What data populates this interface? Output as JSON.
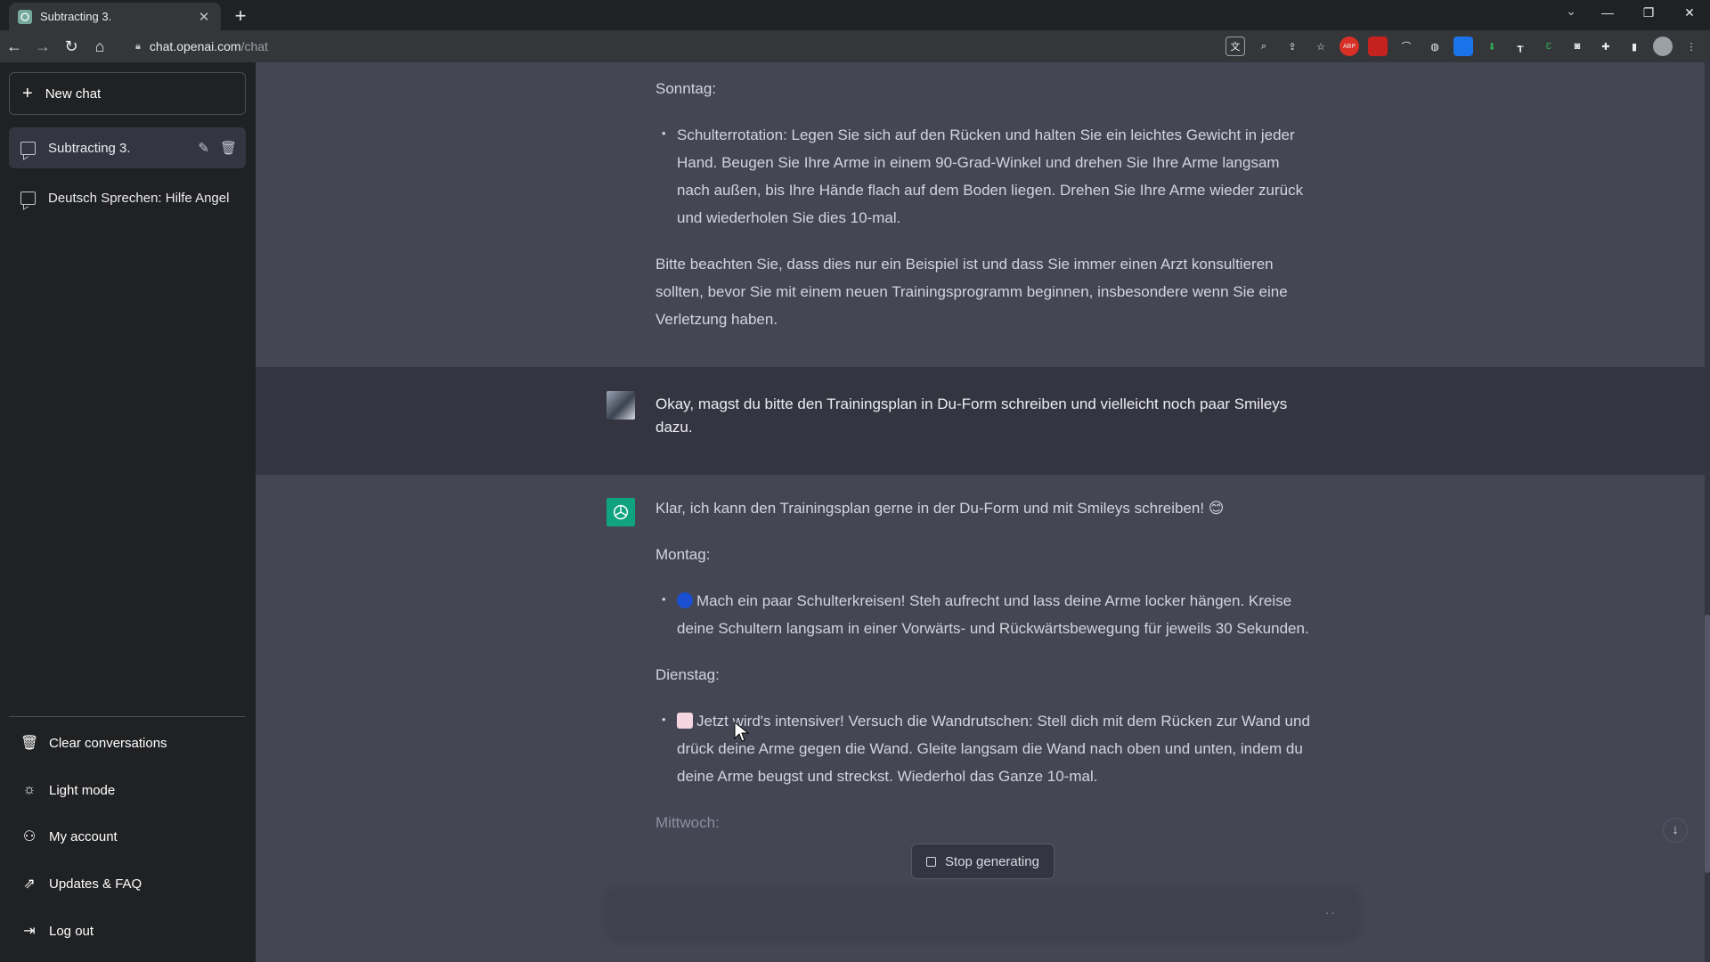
{
  "browser": {
    "tab_title": "Subtracting 3.",
    "tab_close": "✕",
    "new_tab": "+",
    "url_host": "chat.openai.com",
    "url_path": "/chat",
    "window_controls": [
      "—",
      "❐",
      "✕"
    ]
  },
  "sidebar": {
    "new_chat_label": "New chat",
    "conversations": [
      {
        "label": "Subtracting 3.",
        "active": true
      },
      {
        "label": "Deutsch Sprechen: Hilfe Angel",
        "active": false
      }
    ],
    "menu": [
      {
        "label": "Clear conversations",
        "icon": "trash-icon"
      },
      {
        "label": "Light mode",
        "icon": "sun-icon"
      },
      {
        "label": "My account",
        "icon": "user-icon"
      },
      {
        "label": "Updates & FAQ",
        "icon": "external-link-icon"
      },
      {
        "label": "Log out",
        "icon": "logout-icon"
      }
    ]
  },
  "messages": {
    "ai1": {
      "heading": "Sonntag:",
      "bullet": "Schulterrotation: Legen Sie sich auf den Rücken und halten Sie ein leichtes Gewicht in jeder Hand. Beugen Sie Ihre Arme in einem 90-Grad-Winkel und drehen Sie Ihre Arme langsam nach außen, bis Ihre Hände flach auf dem Boden liegen. Drehen Sie Ihre Arme wieder zurück und wiederholen Sie dies 10-mal.",
      "closing": "Bitte beachten Sie, dass dies nur ein Beispiel ist und dass Sie immer einen Arzt konsultieren sollten, bevor Sie mit einem neuen Trainingsprogramm beginnen, insbesondere wenn Sie eine Verletzung haben."
    },
    "user": {
      "text": "Okay, magst du bitte den Trainingsplan in Du-Form schreiben und vielleicht noch paar Smileys dazu."
    },
    "ai2": {
      "intro": "Klar, ich kann den Trainingsplan gerne in der Du-Form und mit Smileys schreiben! 😊",
      "day1": "Montag:",
      "day1_bullet": "Mach ein paar Schulterkreisen! Steh aufrecht und lass deine Arme locker hängen. Kreise deine Schultern langsam in einer Vorwärts- und Rückwärtsbewegung für jeweils 30 Sekunden.",
      "day2": "Dienstag:",
      "day2_bullet": "Jetzt wird's intensiver! Versuch die Wandrutschen: Stell dich mit dem Rücken zur Wand und drück deine Arme gegen die Wand. Gleite langsam die Wand nach oben und unten, indem du deine Arme beugst und streckst. Wiederhol das Ganze 10-mal.",
      "day3": "Mittwoch:"
    }
  },
  "controls": {
    "stop_label": "Stop generating",
    "input_dots": "··",
    "scroll_down": "↓"
  },
  "colors": {
    "sidebar_bg": "#202123",
    "ai_bg": "#444654",
    "user_bg": "#343541",
    "gpt_green": "#10a37f"
  }
}
